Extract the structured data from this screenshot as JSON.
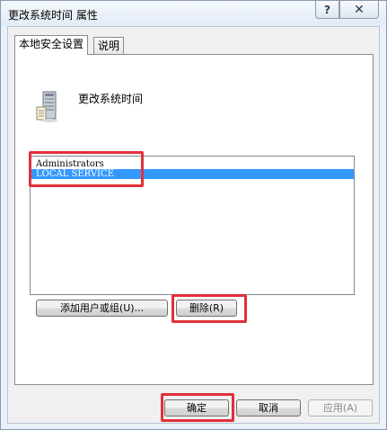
{
  "window": {
    "title": "更改系统时间 属性",
    "help_label": "?",
    "close_label": "✕"
  },
  "tabs": [
    {
      "label": "本地安全设置",
      "active": true
    },
    {
      "label": "说明",
      "active": false
    }
  ],
  "policy": {
    "title": "更改系统时间",
    "icon": "server-icon"
  },
  "accounts": [
    {
      "name": "Administrators",
      "selected": false
    },
    {
      "name": "LOCAL SERVICE",
      "selected": true
    }
  ],
  "actions": {
    "add_label": "添加用户或组(U)...",
    "remove_label": "删除(R)"
  },
  "footer": {
    "ok_label": "确定",
    "cancel_label": "取消",
    "apply_label": "应用(A)"
  },
  "colors": {
    "selection": "#3399ff",
    "highlight": "#e0303a"
  }
}
